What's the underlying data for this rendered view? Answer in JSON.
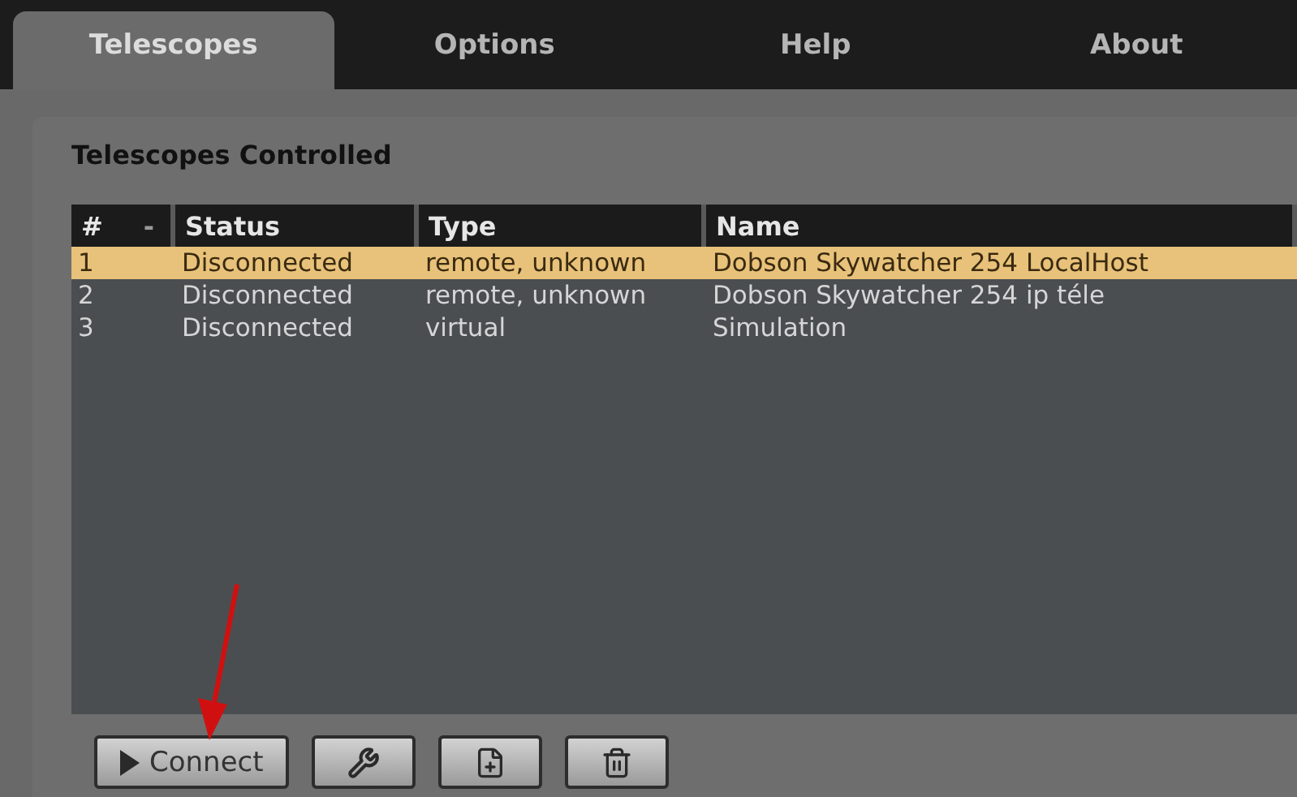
{
  "tabs": [
    {
      "label": "Telescopes",
      "selected": true
    },
    {
      "label": "Options",
      "selected": false
    },
    {
      "label": "Help",
      "selected": false
    },
    {
      "label": "About",
      "selected": false
    }
  ],
  "panel": {
    "title": "Telescopes Controlled",
    "table": {
      "columns": [
        {
          "label": "#",
          "sort_indicator": "-"
        },
        {
          "label": "Status"
        },
        {
          "label": "Type"
        },
        {
          "label": "Name"
        }
      ],
      "rows": [
        {
          "cells": [
            "1",
            "Disconnected",
            "remote, unknown",
            "Dobson Skywatcher 254 LocalHost"
          ],
          "selected": true
        },
        {
          "cells": [
            "2",
            "Disconnected",
            "remote, unknown",
            "Dobson Skywatcher 254 ip téle"
          ],
          "selected": false
        },
        {
          "cells": [
            "3",
            "Disconnected",
            "virtual",
            "Simulation"
          ],
          "selected": false
        }
      ]
    },
    "buttons": [
      {
        "kind": "connect",
        "label": "Connect"
      },
      {
        "kind": "configure"
      },
      {
        "kind": "add"
      },
      {
        "kind": "delete"
      }
    ]
  }
}
